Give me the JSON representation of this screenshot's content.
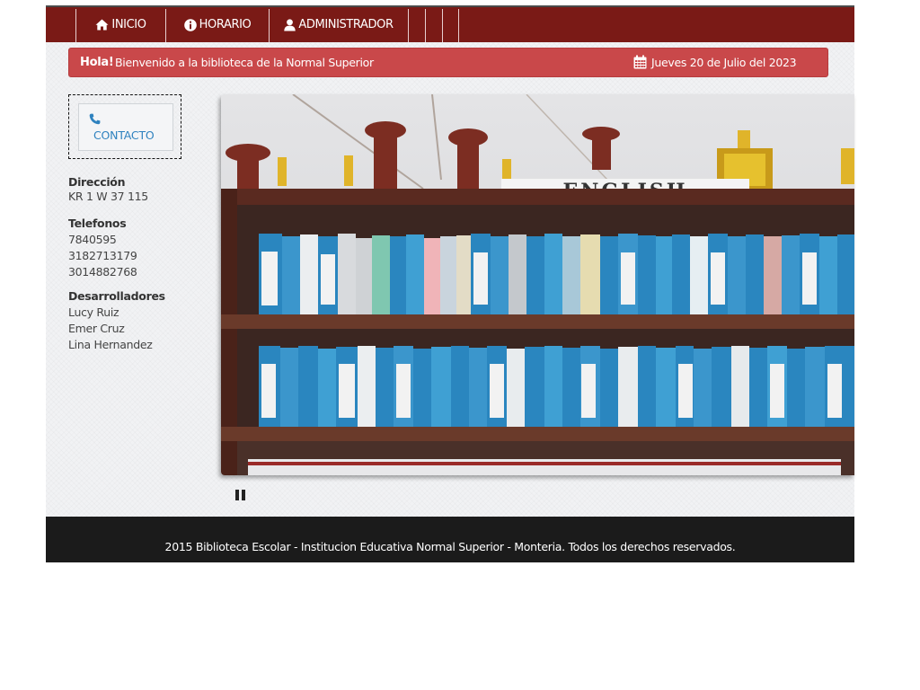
{
  "nav": {
    "items": [
      {
        "label": "INICIO",
        "icon": "home-icon"
      },
      {
        "label": "HORARIO",
        "icon": "info-icon"
      },
      {
        "label": "ADMINISTRADOR",
        "icon": "user-icon"
      }
    ]
  },
  "greeting": {
    "hola": "Hola!",
    "message": "Bienvenido a la biblioteca de la Normal Superior",
    "date": "Jueves 20 de Julio del 2023",
    "date_icon": "calendar-icon"
  },
  "sidebar": {
    "contact_label": "CONTACTO",
    "contact_icon": "phone-icon",
    "address_heading": "Dirección",
    "address": "KR 1 W 37 115",
    "phones_heading": "Telefonos",
    "phones": [
      "7840595",
      "3182713179",
      "3014882768"
    ],
    "devs_heading": "Desarrolladores",
    "devs": [
      "Lucy Ruiz",
      "Emer Cruz",
      "Lina Hernandez"
    ]
  },
  "slider": {
    "shelf_sign": "ENGLISH",
    "pause_icon": "pause-icon"
  },
  "footer": {
    "text": "2015 Biblioteca Escolar - Institucion Educativa Normal Superior - Monteria. Todos los derechos reservados."
  },
  "colors": {
    "nav_bg": "#7a1a16",
    "greeting_bg": "#c9484a",
    "link": "#2f82bf",
    "footer_bg": "#1b1b1b"
  }
}
